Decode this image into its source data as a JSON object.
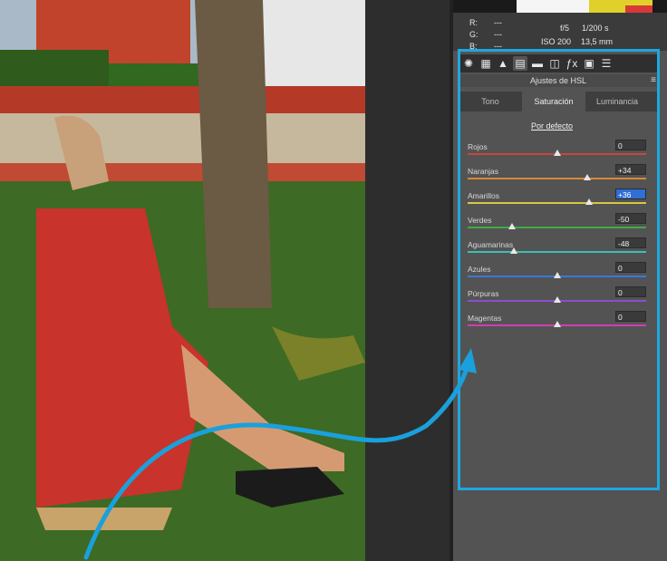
{
  "info": {
    "r_label": "R:",
    "r_value": "---",
    "g_label": "G:",
    "g_value": "---",
    "b_label": "B:",
    "b_value": "---",
    "aperture": "f/5",
    "shutter": "1/200 s",
    "iso": "ISO 200",
    "focal": "13,5 mm"
  },
  "toolbar": {
    "icons": [
      "aperture-icon",
      "grid-icon",
      "tone-curve-icon",
      "hsl-icon",
      "split-toning-icon",
      "lens-icon",
      "fx-icon",
      "camera-calibration-icon",
      "presets-icon"
    ],
    "active_index": 3
  },
  "section_title": "Ajustes de HSL",
  "menu_glyph": "≡",
  "tabs": [
    "Tono",
    "Saturación",
    "Luminancia"
  ],
  "active_tab": 1,
  "default_link": "Por defecto",
  "sliders": [
    {
      "label": "Rojos",
      "value": "0",
      "level": 0,
      "color": "#c9463d"
    },
    {
      "label": "Naranjas",
      "value": "+34",
      "level": 34,
      "color": "#d8873a"
    },
    {
      "label": "Amarillos",
      "value": "+36",
      "level": 36,
      "color": "#d6c941",
      "selected": true
    },
    {
      "label": "Verdes",
      "value": "-50",
      "level": -50,
      "color": "#3faa47"
    },
    {
      "label": "Aguamarinas",
      "value": "-48",
      "level": -48,
      "color": "#3ac0b4"
    },
    {
      "label": "Azules",
      "value": "0",
      "level": 0,
      "color": "#3a78d6"
    },
    {
      "label": "Púrpuras",
      "value": "0",
      "level": 0,
      "color": "#8a4ed0"
    },
    {
      "label": "Magentas",
      "value": "0",
      "level": 0,
      "color": "#cf3fae"
    }
  ],
  "accent_color": "#1ea7e0"
}
